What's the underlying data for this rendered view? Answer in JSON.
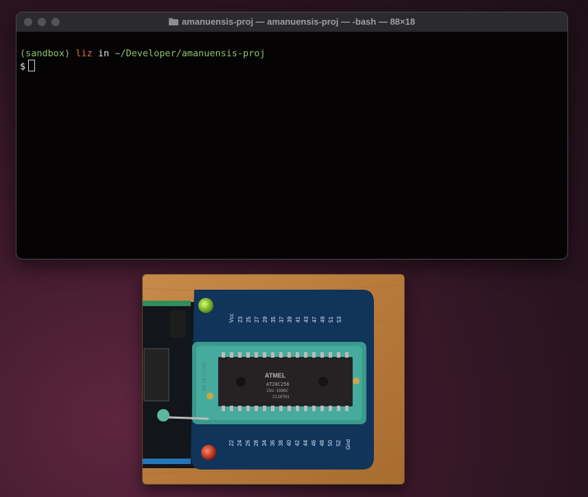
{
  "window": {
    "title": "amanuensis-proj — amanuensis-proj — -bash — 88×18",
    "folder_icon": "folder-icon"
  },
  "terminal": {
    "prompt_env": "(sandbox)",
    "prompt_user": "liz",
    "prompt_in": "in",
    "prompt_path": "~/Developer/amanuensis-proj",
    "prompt_symbol": "$"
  },
  "photo": {
    "chip_brand": "ATMEL",
    "chip_model": "AT28C256",
    "chip_line2": "15U-1980C",
    "chip_line3": "2116TH1",
    "top_pins": [
      "Vcc",
      "23",
      "25",
      "27",
      "29",
      "35",
      "37",
      "39",
      "41",
      "43",
      "47",
      "49",
      "51",
      "53"
    ],
    "bottom_pins": [
      "22",
      "24",
      "26",
      "28",
      "34",
      "36",
      "38",
      "40",
      "42",
      "44",
      "46",
      "48",
      "50",
      "52",
      "Gnd"
    ],
    "socket_brand": "3M TEXTOOL"
  }
}
